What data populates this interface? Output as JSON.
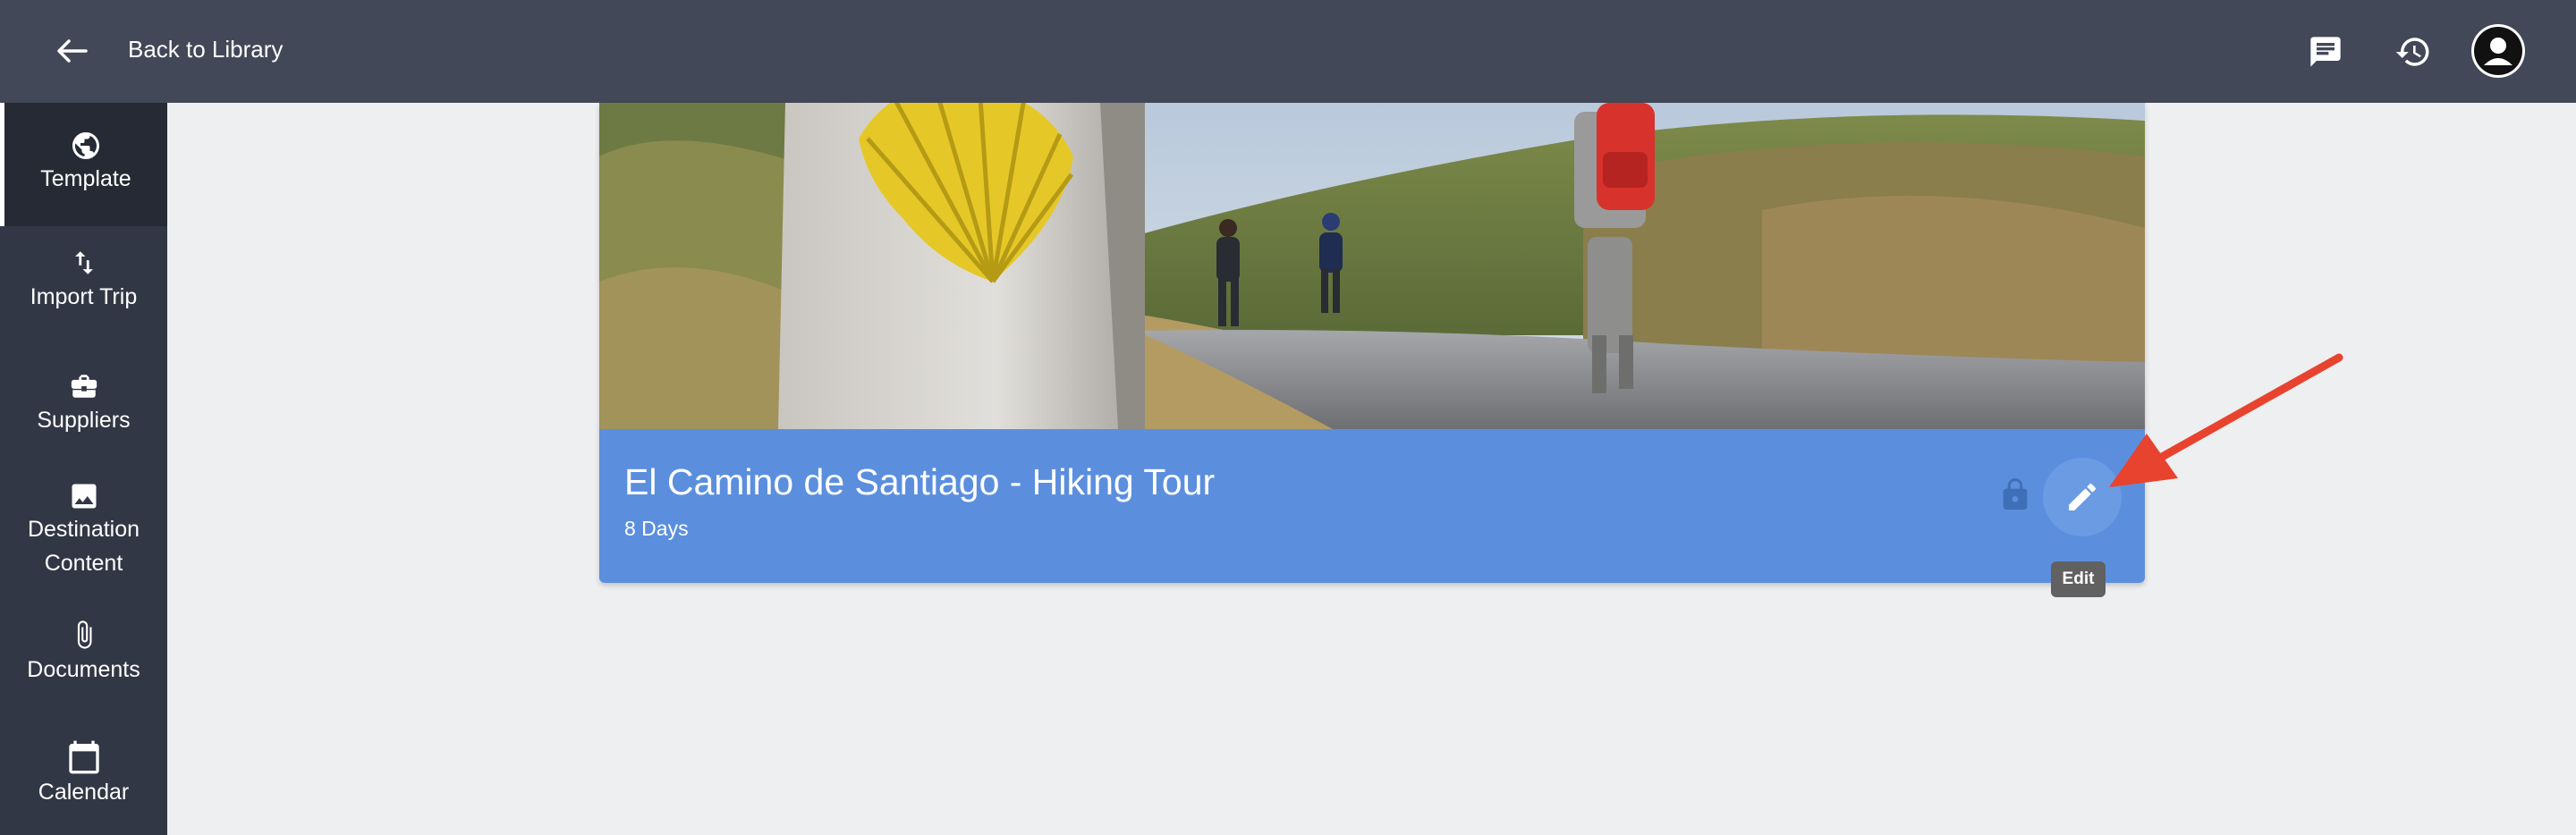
{
  "header": {
    "back_label": "Back to Library",
    "icons": [
      "arrow-left-icon",
      "chat-icon",
      "history-icon",
      "user-avatar-icon"
    ]
  },
  "sidebar": {
    "items": [
      {
        "label": "Template",
        "icon": "globe-icon",
        "active": true
      },
      {
        "label": "Import Trip",
        "icon": "import-arrows-icon",
        "active": false
      },
      {
        "label": "Suppliers",
        "icon": "briefcase-icon",
        "active": false
      },
      {
        "label": "Destination Content",
        "icon": "image-icon",
        "active": false
      },
      {
        "label": "Documents",
        "icon": "paperclip-icon",
        "active": false
      },
      {
        "label": "Calendar",
        "icon": "calendar-icon",
        "active": false
      }
    ]
  },
  "trip": {
    "title": "El Camino de Santiago - Hiking Tour",
    "duration": "8 Days"
  },
  "edit_tooltip": "Edit",
  "colors": {
    "topbar": "#424858",
    "sidebar": "#323745",
    "card_footer": "#5b8fde",
    "annotation_arrow": "#e8432e"
  }
}
